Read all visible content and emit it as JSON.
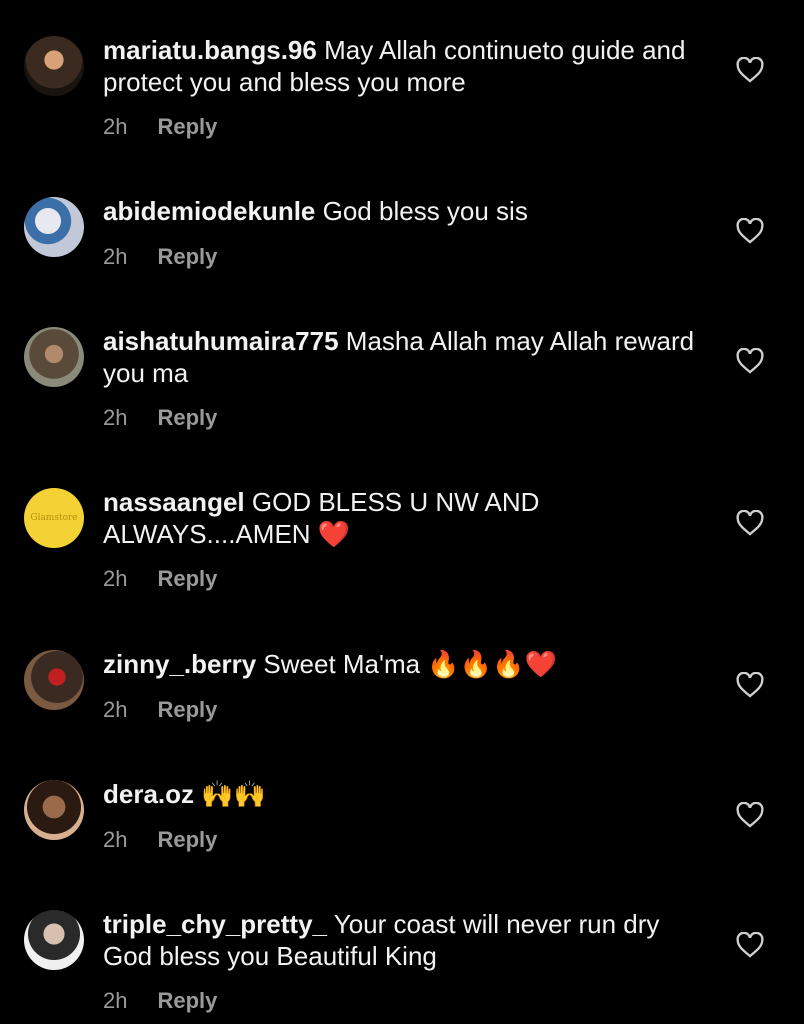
{
  "comments": [
    {
      "username": "mariatu.bangs.96",
      "text": "May Allah continueto guide and protect you and bless you more",
      "emoji": "",
      "time": "2h",
      "reply": "Reply"
    },
    {
      "username": "abidemiodekunle",
      "text": "God bless you sis",
      "emoji": "",
      "time": "2h",
      "reply": "Reply"
    },
    {
      "username": "aishatuhumaira775",
      "text": "Masha Allah may Allah reward you ma",
      "emoji": "",
      "time": "2h",
      "reply": "Reply"
    },
    {
      "username": "nassaangel",
      "text": "GOD BLESS U NW AND ALWAYS....AMEN",
      "emoji": "❤️",
      "time": "2h",
      "reply": "Reply"
    },
    {
      "username": "zinny_.berry",
      "text": "Sweet Ma'ma",
      "emoji": "🔥🔥🔥❤️",
      "time": "2h",
      "reply": "Reply"
    },
    {
      "username": "dera.oz",
      "text": "",
      "emoji": "🙌🙌",
      "time": "2h",
      "reply": "Reply"
    },
    {
      "username": "triple_chy_pretty_",
      "text": "Your coast will never run dry God bless you Beautiful King",
      "emoji": "",
      "time": "2h",
      "reply": "Reply"
    }
  ],
  "avatar4_text": "Glamstore",
  "icons": {
    "like": "heart-outline-icon"
  },
  "colors": {
    "background": "#000000",
    "text": "#f2f2f2",
    "meta": "#9a9a9a",
    "heart_emoji": "#e0182d"
  }
}
